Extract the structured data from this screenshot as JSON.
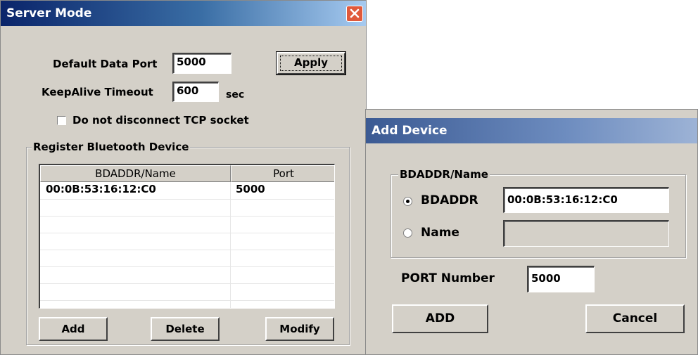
{
  "server_mode": {
    "title": "Server Mode",
    "default_data_port_label": "Default Data Port",
    "default_data_port_value": "5000",
    "apply_label": "Apply",
    "keepalive_label": "KeepAlive Timeout",
    "keepalive_value": "600",
    "keepalive_unit": "sec",
    "no_disconnect_label": "Do not disconnect TCP socket",
    "no_disconnect_checked": false,
    "register_group_title": "Register Bluetooth Device",
    "columns": [
      "BDADDR/Name",
      "Port"
    ],
    "rows": [
      {
        "bdaddr": "00:0B:53:16:12:C0",
        "port": "5000"
      }
    ],
    "add_label": "Add",
    "delete_label": "Delete",
    "modify_label": "Modify"
  },
  "add_device": {
    "title": "Add Device",
    "group_title": "BDADDR/Name",
    "bdaddr_label": "BDADDR",
    "bdaddr_value": "00:0B:53:16:12:C0",
    "name_label": "Name",
    "name_value": "",
    "selected": "BDADDR",
    "port_label": "PORT Number",
    "port_value": "5000",
    "add_label": "ADD",
    "cancel_label": "Cancel"
  }
}
